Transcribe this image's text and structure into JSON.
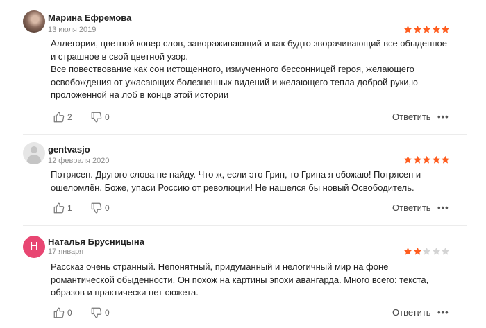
{
  "colors": {
    "star_filled": "#ff5d1f",
    "star_empty": "#d4d4d4",
    "avatar_letter_bg": "#e84672"
  },
  "actions": {
    "reply_label": "Ответить",
    "more_label": "•••"
  },
  "reviews": [
    {
      "author": "Марина Ефремова",
      "date": "13 июля 2019",
      "rating": 5,
      "avatar_type": "photo",
      "paragraphs": [
        "Аллегории, цветной ковер слов, завораживающий и как будто зворачивающий все обыденное и страшное в свой цветной узор.",
        "Все повествование как сон истощенного, измученного бессонницей героя, желающего освобождения от ужасающих болезненных видений и желающего тепла доброй руки,ю проложенной на лоб в конце этой истории"
      ],
      "likes": "2",
      "dislikes": "0"
    },
    {
      "author": "gentvasjo",
      "date": "12 февраля 2020",
      "rating": 5,
      "avatar_type": "placeholder",
      "paragraphs": [
        "Потрясен. Другого слова не найду. Что ж, если это Грин, то Грина я обожаю! Потрясен и ошеломлён. Боже, упаси Россию от революции! Не нашелся бы новый Освободитель."
      ],
      "likes": "1",
      "dislikes": "0"
    },
    {
      "author": "Наталья Брусницына",
      "date": "17 января",
      "rating": 2,
      "avatar_type": "letter",
      "avatar_letter": "Н",
      "paragraphs": [
        "Рассказ очень странный. Непонятный, придуманный и нелогичный мир на фоне романтической обыденности. Он похож на картины эпохи авангарда. Много всего: текста, образов и практически нет сюжета."
      ],
      "likes": "0",
      "dislikes": "0"
    }
  ]
}
